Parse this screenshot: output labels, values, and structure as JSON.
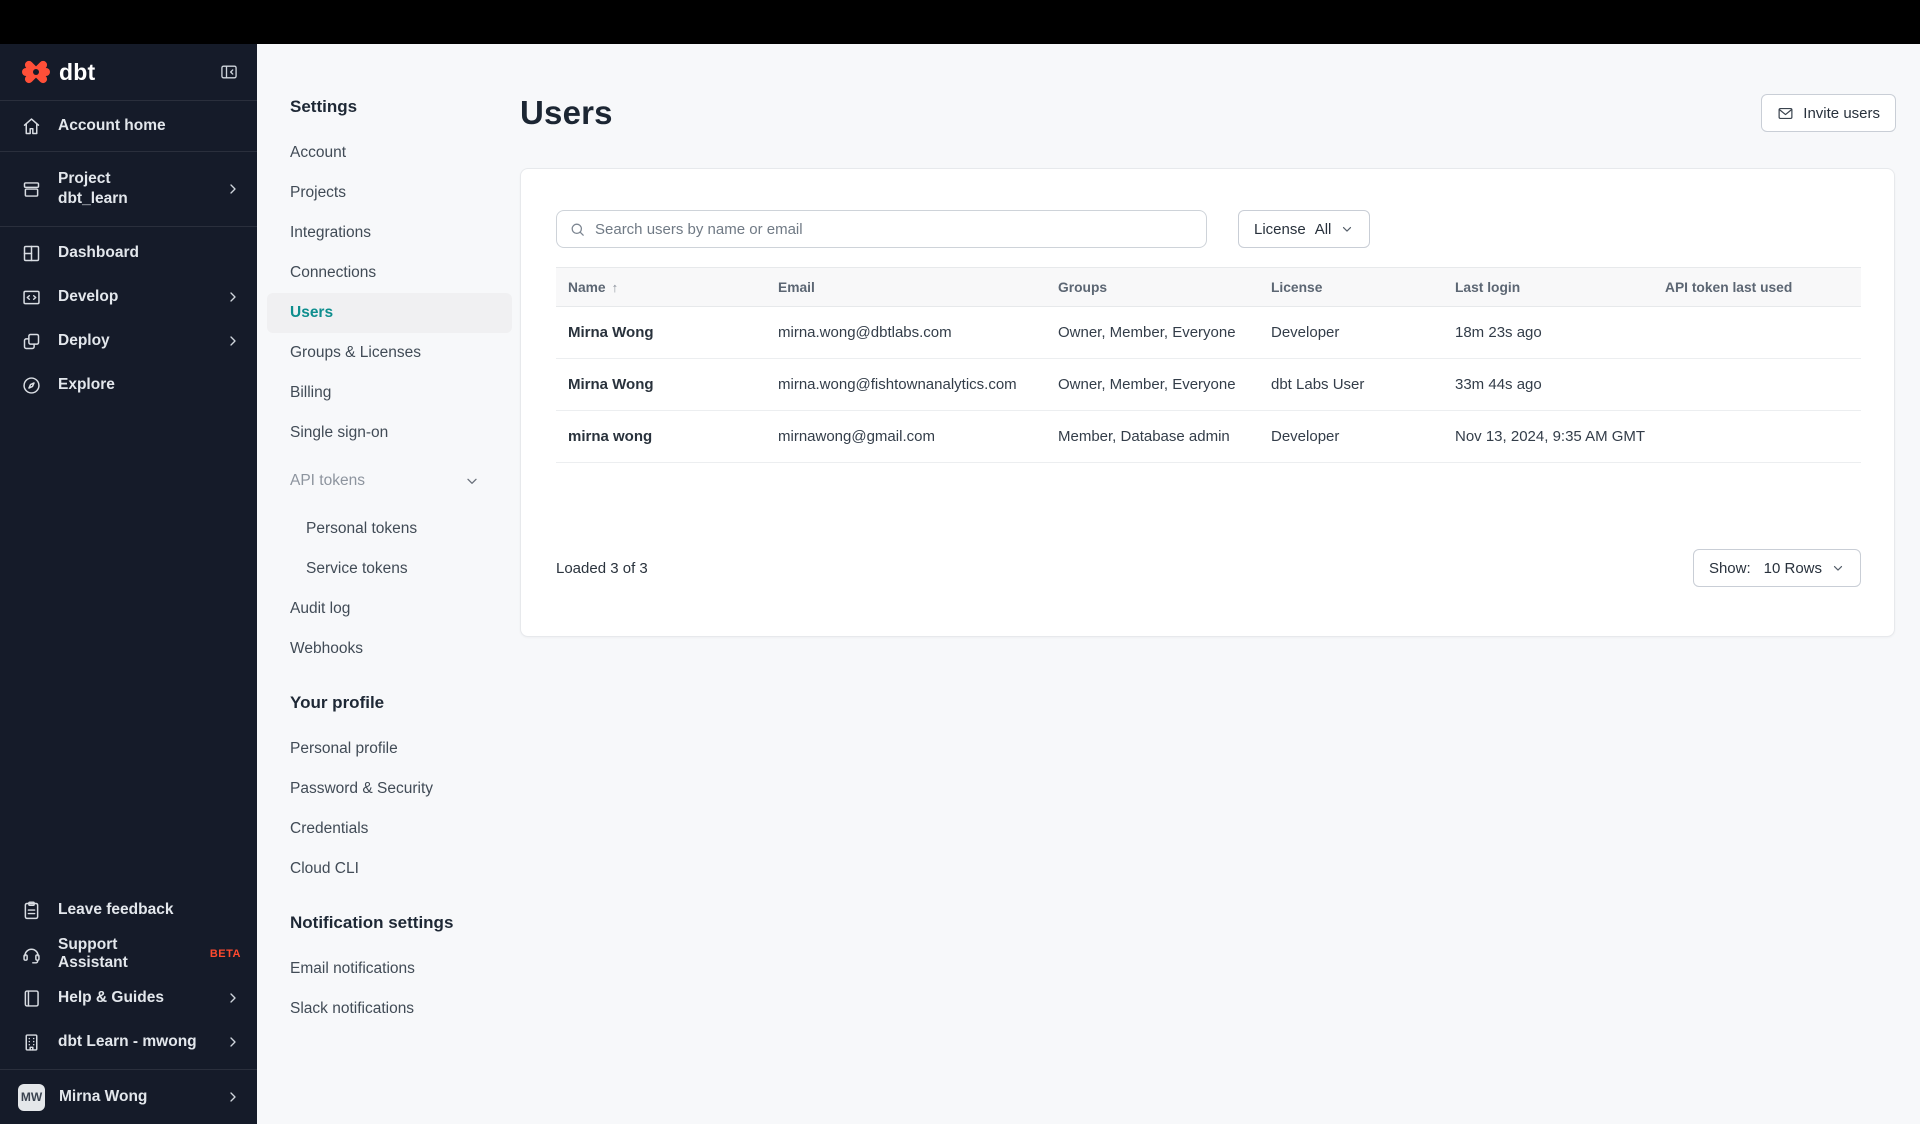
{
  "colors": {
    "accent": "#ff4a2e",
    "active_link": "#0e8e8e",
    "sidebar_bg": "#151b29",
    "topbar_bg": "#000000"
  },
  "sidebar": {
    "logo_text": "dbt",
    "items": {
      "account_home": {
        "label": "Account home"
      },
      "project": {
        "label": "Project",
        "sublabel": "dbt_learn"
      },
      "dashboard": {
        "label": "Dashboard"
      },
      "develop": {
        "label": "Develop"
      },
      "deploy": {
        "label": "Deploy"
      },
      "explore": {
        "label": "Explore"
      }
    },
    "footer": {
      "leave_feedback": {
        "label": "Leave feedback"
      },
      "support_assistant": {
        "label": "Support Assistant",
        "badge": "BETA"
      },
      "help_guides": {
        "label": "Help & Guides"
      },
      "dbt_learn": {
        "label": "dbt Learn - mwong"
      },
      "user": {
        "label": "Mirna Wong",
        "avatar_initials": "MW"
      }
    }
  },
  "settings_nav": {
    "heading": "Settings",
    "items": [
      {
        "label": "Account"
      },
      {
        "label": "Projects"
      },
      {
        "label": "Integrations"
      },
      {
        "label": "Connections"
      },
      {
        "label": "Users"
      },
      {
        "label": "Groups & Licenses"
      },
      {
        "label": "Billing"
      },
      {
        "label": "Single sign-on"
      }
    ],
    "api_tokens": {
      "label": "API tokens",
      "children": [
        {
          "label": "Personal tokens"
        },
        {
          "label": "Service tokens"
        }
      ]
    },
    "items2": [
      {
        "label": "Audit log"
      },
      {
        "label": "Webhooks"
      }
    ],
    "profile": {
      "heading": "Your profile",
      "items": [
        {
          "label": "Personal profile"
        },
        {
          "label": "Password & Security"
        },
        {
          "label": "Credentials"
        },
        {
          "label": "Cloud CLI"
        }
      ]
    },
    "notifications": {
      "heading": "Notification settings",
      "items": [
        {
          "label": "Email notifications"
        },
        {
          "label": "Slack notifications"
        }
      ]
    }
  },
  "main": {
    "title": "Users",
    "invite_button": "Invite users",
    "search_placeholder": "Search users by name or email",
    "license_filter": {
      "label": "License",
      "value": "All"
    },
    "table": {
      "headers": [
        "Name",
        "Email",
        "Groups",
        "License",
        "Last login",
        "API token last used"
      ],
      "rows": [
        {
          "name": "Mirna Wong",
          "email": "mirna.wong@dbtlabs.com",
          "groups": "Owner, Member, Everyone",
          "license": "Developer",
          "last_login": "18m 23s ago",
          "api_token_last_used": ""
        },
        {
          "name": "Mirna Wong",
          "email": "mirna.wong@fishtownanalytics.com",
          "groups": "Owner, Member, Everyone",
          "license": "dbt Labs User",
          "last_login": "33m 44s ago",
          "api_token_last_used": ""
        },
        {
          "name": "mirna wong",
          "email": "mirnawong@gmail.com",
          "groups": "Member, Database admin",
          "license": "Developer",
          "last_login": "Nov 13, 2024, 9:35 AM GMT",
          "api_token_last_used": ""
        }
      ]
    },
    "footer": {
      "loaded": "Loaded 3 of 3",
      "show_label": "Show:",
      "show_value": "10 Rows"
    }
  }
}
